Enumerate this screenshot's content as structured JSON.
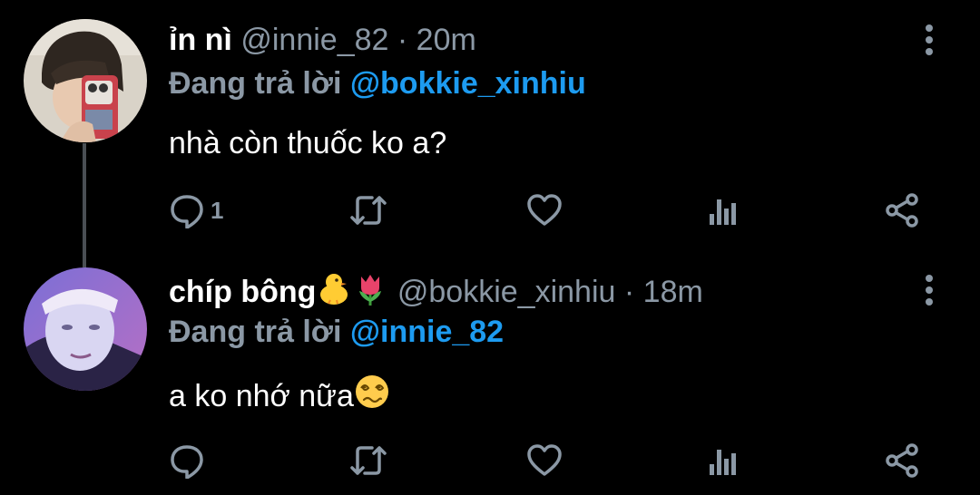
{
  "tweets": [
    {
      "name": "ỉn nì",
      "name_emoji": [],
      "handle": "@innie_82",
      "separator": "·",
      "time": "20m",
      "reply_prefix": "Đang trả lời",
      "reply_to": "@bokkie_xinhiu",
      "text": "nhà còn thuốc ko a?",
      "text_emoji": [],
      "actions": {
        "reply_count": "1"
      }
    },
    {
      "name": "chíp bông",
      "name_emoji": [
        "chick-emoji",
        "tulip-emoji"
      ],
      "handle": "@bokkie_xinhiu",
      "separator": "·",
      "time": "18m",
      "reply_prefix": "Đang trả lời",
      "reply_to": "@innie_82",
      "text": "a ko nhớ nữa",
      "text_emoji": [
        "dizzy-face-emoji"
      ],
      "actions": {
        "reply_count": ""
      }
    }
  ],
  "colors": {
    "background": "#000000",
    "text": "#ffffff",
    "muted": "#8b98a5",
    "mention": "#1d9bf0",
    "thread_line": "#4a4f54"
  },
  "icons": [
    "reply-icon",
    "retweet-icon",
    "like-icon",
    "analytics-icon",
    "share-icon",
    "more-options-icon"
  ]
}
